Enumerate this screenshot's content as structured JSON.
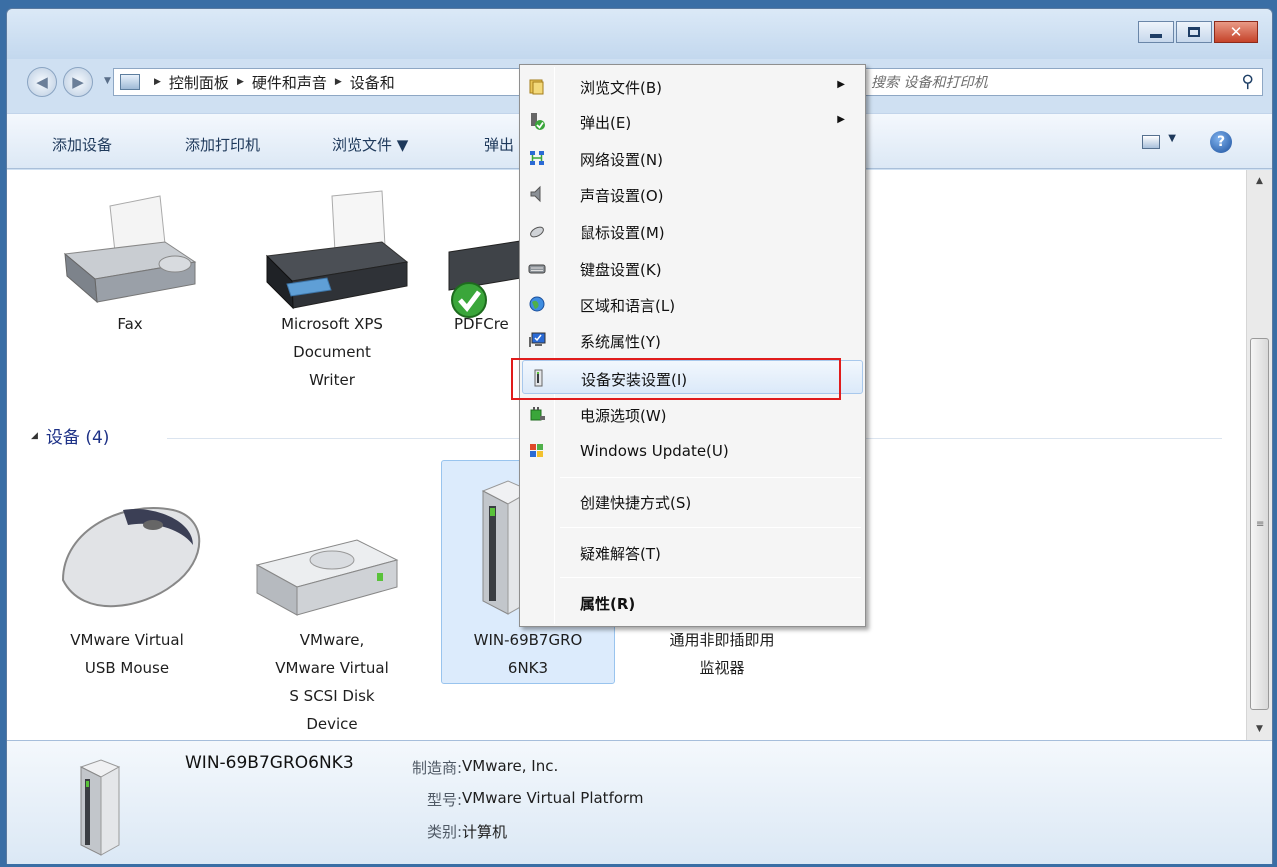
{
  "window": {
    "min_label": "",
    "max_label": "",
    "close_label": "✕"
  },
  "address": {
    "crumbs": [
      "控制面板",
      "硬件和声音",
      "设备和打印机"
    ],
    "visible_crumb_3": "设备和"
  },
  "search": {
    "placeholder": "搜索 设备和打印机",
    "icon": "search-icon"
  },
  "toolbar": {
    "add_device": "添加设备",
    "add_printer": "添加打印机",
    "browse_files": "浏览文件 ▼",
    "eject": "弹出"
  },
  "printers": [
    {
      "name_line1": "Fax",
      "name_line2": "",
      "name_line3": ""
    },
    {
      "name_line1": "Microsoft XPS",
      "name_line2": "Document",
      "name_line3": "Writer"
    },
    {
      "name_line1": "PDFCre",
      "name_line2": "",
      "name_line3": ""
    }
  ],
  "group": {
    "label": "设备 (4)"
  },
  "devices": [
    {
      "line1": "VMware Virtual",
      "line2": "USB Mouse",
      "line3": "",
      "line4": ""
    },
    {
      "line1": "VMware,",
      "line2": "VMware Virtual",
      "line3": "S SCSI Disk",
      "line4": "Device"
    },
    {
      "line1": "WIN-69B7GRO",
      "line2": "6NK3",
      "line3": "",
      "line4": ""
    },
    {
      "line1": "通用非即插即用",
      "line2": "监视器",
      "line3": "",
      "line4": ""
    }
  ],
  "details": {
    "name": "WIN-69B7GRO6NK3",
    "manufacturer_key": "制造商:",
    "manufacturer_val": "VMware, Inc.",
    "model_key": "型号:",
    "model_val": "VMware Virtual Platform",
    "category_key": "类别:",
    "category_val": "计算机"
  },
  "context_menu": {
    "items": [
      {
        "label": "浏览文件(B)",
        "icon": "folder-icon",
        "submenu": true
      },
      {
        "label": "弹出(E)",
        "icon": "eject-icon",
        "submenu": true
      },
      {
        "label": "网络设置(N)",
        "icon": "network-icon"
      },
      {
        "label": "声音设置(O)",
        "icon": "speaker-icon"
      },
      {
        "label": "鼠标设置(M)",
        "icon": "mouse-icon"
      },
      {
        "label": "键盘设置(K)",
        "icon": "keyboard-icon"
      },
      {
        "label": "区域和语言(L)",
        "icon": "globe-icon"
      },
      {
        "label": "系统属性(Y)",
        "icon": "system-icon"
      },
      {
        "label": "设备安装设置(I)",
        "icon": "device-install-icon",
        "highlighted": true
      },
      {
        "label": "电源选项(W)",
        "icon": "power-icon"
      },
      {
        "label": "Windows Update(U)",
        "icon": "windows-update-icon"
      },
      {
        "label": "创建快捷方式(S)"
      },
      {
        "label": "疑难解答(T)"
      },
      {
        "label": "属性(R)",
        "bold": true
      }
    ],
    "submenu_arrow": "▶"
  },
  "colors": {
    "highlight_box": "#e01c1c",
    "group_header": "#1e3287",
    "selection": "#dcebfc"
  }
}
